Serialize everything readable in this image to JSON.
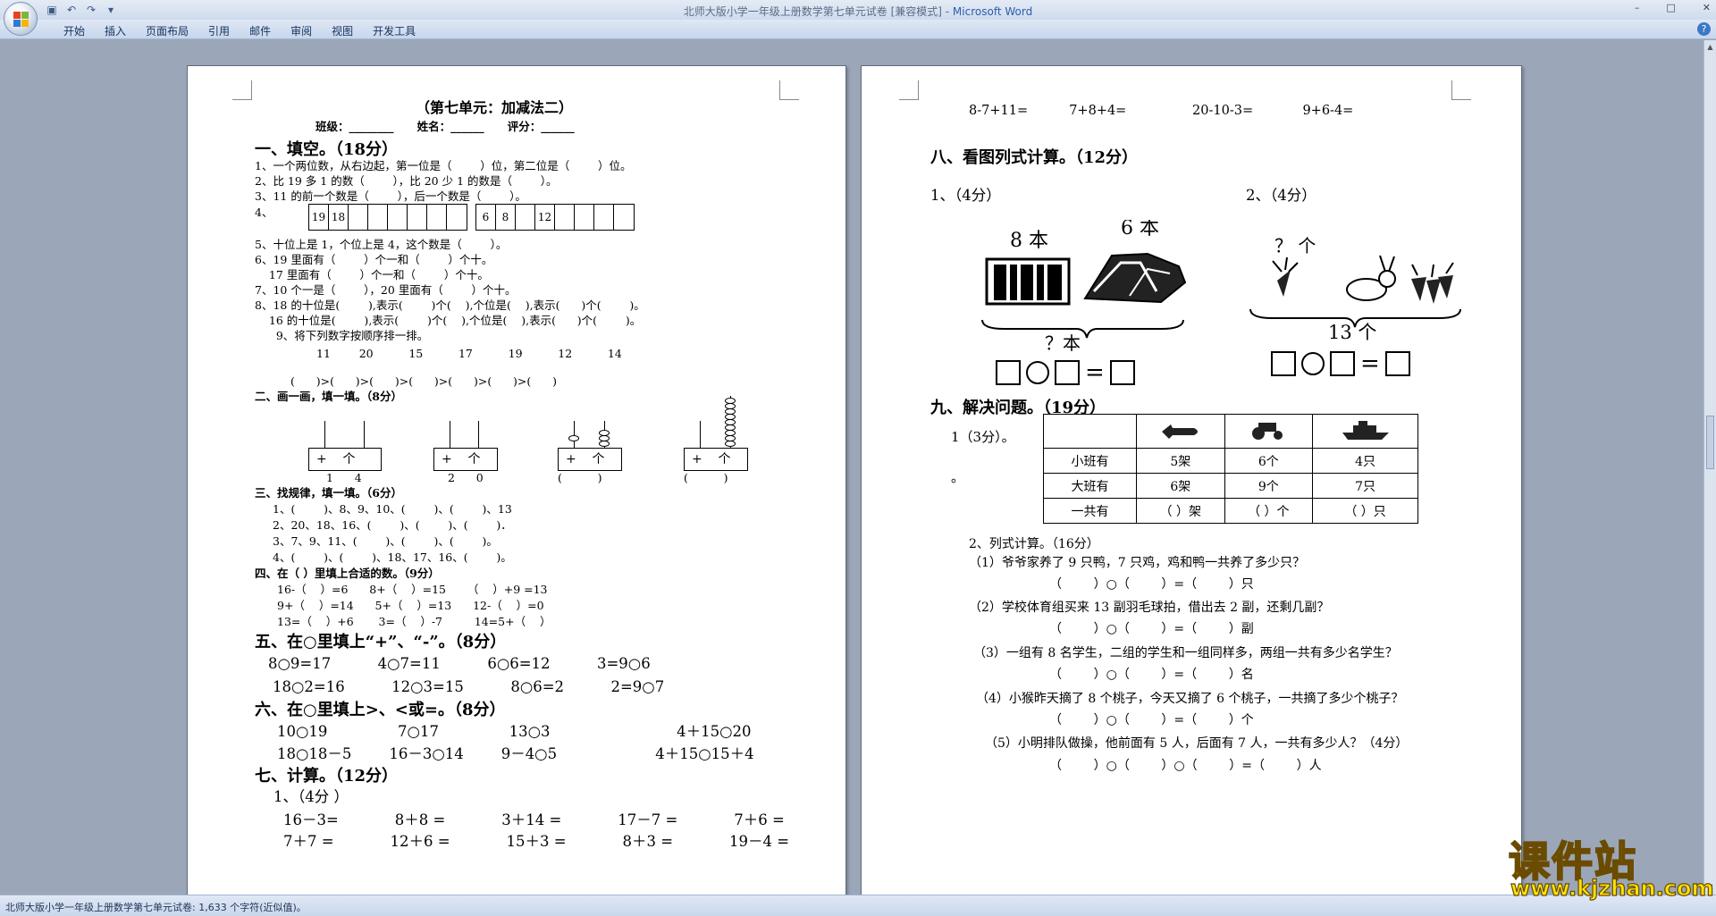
{
  "window": {
    "title_doc": "北师大版小学一年级上册数学第七单元试卷 [兼容模式] - ",
    "title_app": "Microsoft Word",
    "controls": [
      "–",
      "□",
      "✕"
    ]
  },
  "quick_access": [
    "save-icon",
    "undo-icon",
    "redo-icon",
    "customize-icon"
  ],
  "ribbon_tabs": [
    "开始",
    "插入",
    "页面布局",
    "引用",
    "邮件",
    "审阅",
    "视图",
    "开发工具"
  ],
  "status": {
    "text": "北师大版小学一年级上册数学第七单元试卷: 1,633 个字符(近似值)。"
  },
  "watermark": {
    "brand": "课件站",
    "url": "www.kjzhan.com"
  },
  "page1": {
    "title": "（第七单元：加减法二）",
    "info": "班级：________      姓名：______      评分：______",
    "s1": "一、填空。（18分）",
    "s1_lines": [
      "1、一个两位数，从右边起，第一位是（        ）位，第二位是（        ）位。",
      "2、比 19 多 1 的数（        ），比 20 少 1 的数是（        ）。",
      "3、11 的前一个数是（        ），后一个数是（        ）。",
      "4、"
    ],
    "grid1": [
      "19",
      "18",
      "",
      "",
      "",
      "",
      "",
      ""
    ],
    "grid2": [
      "6",
      "8",
      "",
      "12",
      "",
      "",
      "",
      ""
    ],
    "s1_lines_b": [
      "5、十位上是 1，个位上是 4，这个数是（        ）。",
      "6、19 里面有（        ）个一和（        ）个十。",
      "    17 里面有（        ）个一和（        ）个十。",
      "7、10 个一是（        ），20 里面有（        ）个十。",
      "8、18 的十位是(        ),表示(        )个(    ),个位是(    ),表示(      )个(        )。",
      "    16 的十位是(        ),表示(        )个(    ),个位是(    ),表示(      )个(        )。",
      "      9、将下列数字按顺序排一排。"
    ],
    "order_nums": "11        20          15          17          19          12          14",
    "order_blanks": "(      )>(      )>(      )>(      )>(      )>(      )>(      )",
    "s2": "二、画一画，填一填。（8分）",
    "abacus_label": "+    个",
    "abacus_vals": [
      "1      4",
      "2      0",
      "(          )",
      "(          )"
    ],
    "s3": "三、找规律，填一填。（6分）",
    "s3_lines": [
      "1、(        )、8、9、10、(        )、(        )、13",
      "2、20、18、16、(        )、(        )、(        )．",
      "3、7、9、11、(        )、(        )、(        )。",
      "4、(        )、(        )、18、17、16、(        )。"
    ],
    "s4": "四、在（  ）里填上合适的数。（9分）",
    "s4_lines": [
      "16-（    ）=6      8+（    ）=15      （    ）+9 =13",
      "9+（    ）=14      5+（    ）=13      12-（    ）=0",
      "13=（    ）+6       3=（    ）-7         14=5+（    ）"
    ],
    "s5": "五、在○里填上“+”、“-”。（8分）",
    "s5_lines": [
      "8○9=17          4○7=11          6○6=12          3=9○6",
      "18○2=16          12○3=15          8○6=2          2=9○7"
    ],
    "s6": "六、在○里填上>、<或=。（8分）",
    "s6_lines": [
      "10○19               7○17               13○3                           4＋15○20",
      "18○18－5        16－3○14        9－4○5                     4＋15○15＋4"
    ],
    "s7": "七、计算。（12分）",
    "s7_sub": "1、（4分 ）",
    "s7_lines": [
      "16－3=            8＋8 =            3＋14 =            17－7 =            7＋6 =",
      "7＋7 =            12＋6 =            15＋3 =            8＋3 =            19－4 ="
    ]
  },
  "page2": {
    "calc_line": "8-7+11=          7+8+4=                20-10-3=            9+6-4=",
    "s8": "八、看图列式计算。（12分）",
    "s8_q1": "1、（4分）",
    "s8_q2": "2、（4分）",
    "pic1_a": "8 本",
    "pic1_b": "6 本",
    "pic1_q": "？本",
    "pic2_q": "？ 个",
    "pic2_total": "13 个",
    "s9": "九、解决问题。（19分）",
    "s9_q1": "1（3分）。",
    "s9_q1_tail": "。",
    "table_rows": [
      [
        "",
        "plane-icon",
        "tractor-icon",
        "ship-icon"
      ],
      [
        "小班有",
        "5架",
        "6个",
        "4只"
      ],
      [
        "大班有",
        "6架",
        "9个",
        "7只"
      ],
      [
        "一共有",
        "（    ）架",
        "（    ）个",
        "（    ）只"
      ]
    ],
    "s9_q2": "2、列式计算。（16分）",
    "problems": [
      "（1）爷爷家养了 9 只鸭，7 只鸡，鸡和鸭一共养了多少只？",
      "（2）学校体育组买来 13 副羽毛球拍，借出去 2 副，还剩几副？",
      "（3）一组有 8 名学生，二组的学生和一组同样多，两组一共有多少名学生？",
      "（4）小猴昨天摘了 8 个桃子，今天又摘了 6 个桃子，一共摘了多少个桃子？",
      "（5）小明排队做操，他前面有 5 人，后面有 7 人，一共有多少人？（4分）"
    ],
    "answers": [
      "（        ）○（        ）=（        ）只",
      "（        ）○（        ）=（        ）副",
      "（        ）○（        ）=（        ）名",
      "（        ）○（        ）=（        ）个",
      "（        ）○（        ）○（        ）=（        ）人"
    ]
  }
}
